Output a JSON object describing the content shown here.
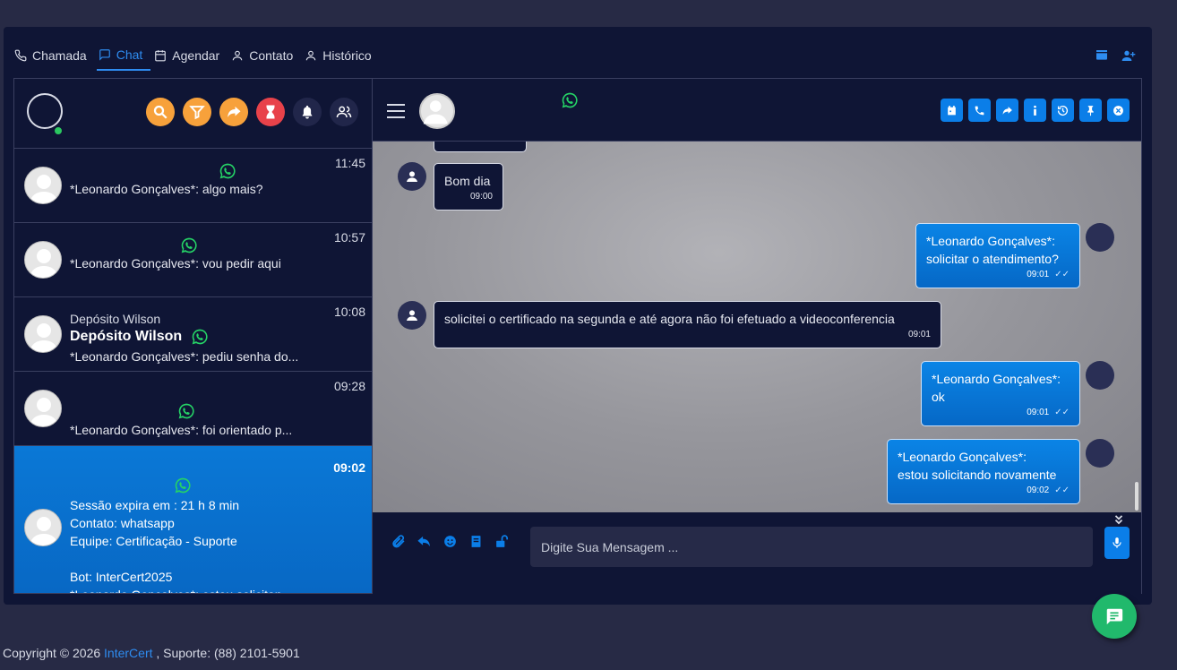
{
  "tabs": [
    {
      "label": "Chamada",
      "icon": "phone-icon"
    },
    {
      "label": "Chat",
      "icon": "chat-icon"
    },
    {
      "label": "Agendar",
      "icon": "calendar-icon"
    },
    {
      "label": "Contato",
      "icon": "user-icon"
    },
    {
      "label": "Histórico",
      "icon": "user-icon"
    }
  ],
  "conversations": [
    {
      "time": "11:45",
      "last": "*Leonardo Gonçalves*: algo mais?"
    },
    {
      "time": "10:57",
      "last": "*Leonardo Gonçalves*: vou pedir aqui"
    },
    {
      "time": "10:08",
      "name_small": "Depósito Wilson",
      "name_big": "Depósito Wilson",
      "last": "*Leonardo Gonçalves*: pediu senha do..."
    },
    {
      "time": "09:28",
      "last": "*Leonardo Gonçalves*: foi orientado p..."
    },
    {
      "time": "09:02",
      "session": "Sessão expira em : 21 h 8 min",
      "contact": "Contato: whatsapp",
      "team": "Equipe: Certificação - Suporte",
      "bot": "Bot: InterCert2025",
      "last": "*Leonardo Gonçalves*: estou solicitan..."
    }
  ],
  "messages": [
    {
      "dir": "in",
      "lines": [
        "Bom dia"
      ],
      "time": "09:00"
    },
    {
      "dir": "out",
      "lines": [
        "*Leonardo Gonçalves*:",
        "solicitar o atendimento?"
      ],
      "time": "09:01"
    },
    {
      "dir": "in",
      "lines": [
        "solicitei o certificado na segunda e até agora não foi efetuado a videoconferencia"
      ],
      "time": "09:01"
    },
    {
      "dir": "out",
      "lines": [
        "*Leonardo Gonçalves*:",
        "ok"
      ],
      "time": "09:01"
    },
    {
      "dir": "out",
      "lines": [
        "*Leonardo Gonçalves*:",
        "estou solicitando novamente"
      ],
      "time": "09:02"
    }
  ],
  "composer": {
    "placeholder": "Digite Sua Mensagem ..."
  },
  "footer": {
    "prefix": "Copyright © 2026 ",
    "brand": "InterCert",
    "suffix": " , Suporte: (88) 2101-5901"
  },
  "colors": {
    "accent": "#0b7ee8",
    "whatsapp": "#25d366",
    "background": "#0f1535"
  }
}
